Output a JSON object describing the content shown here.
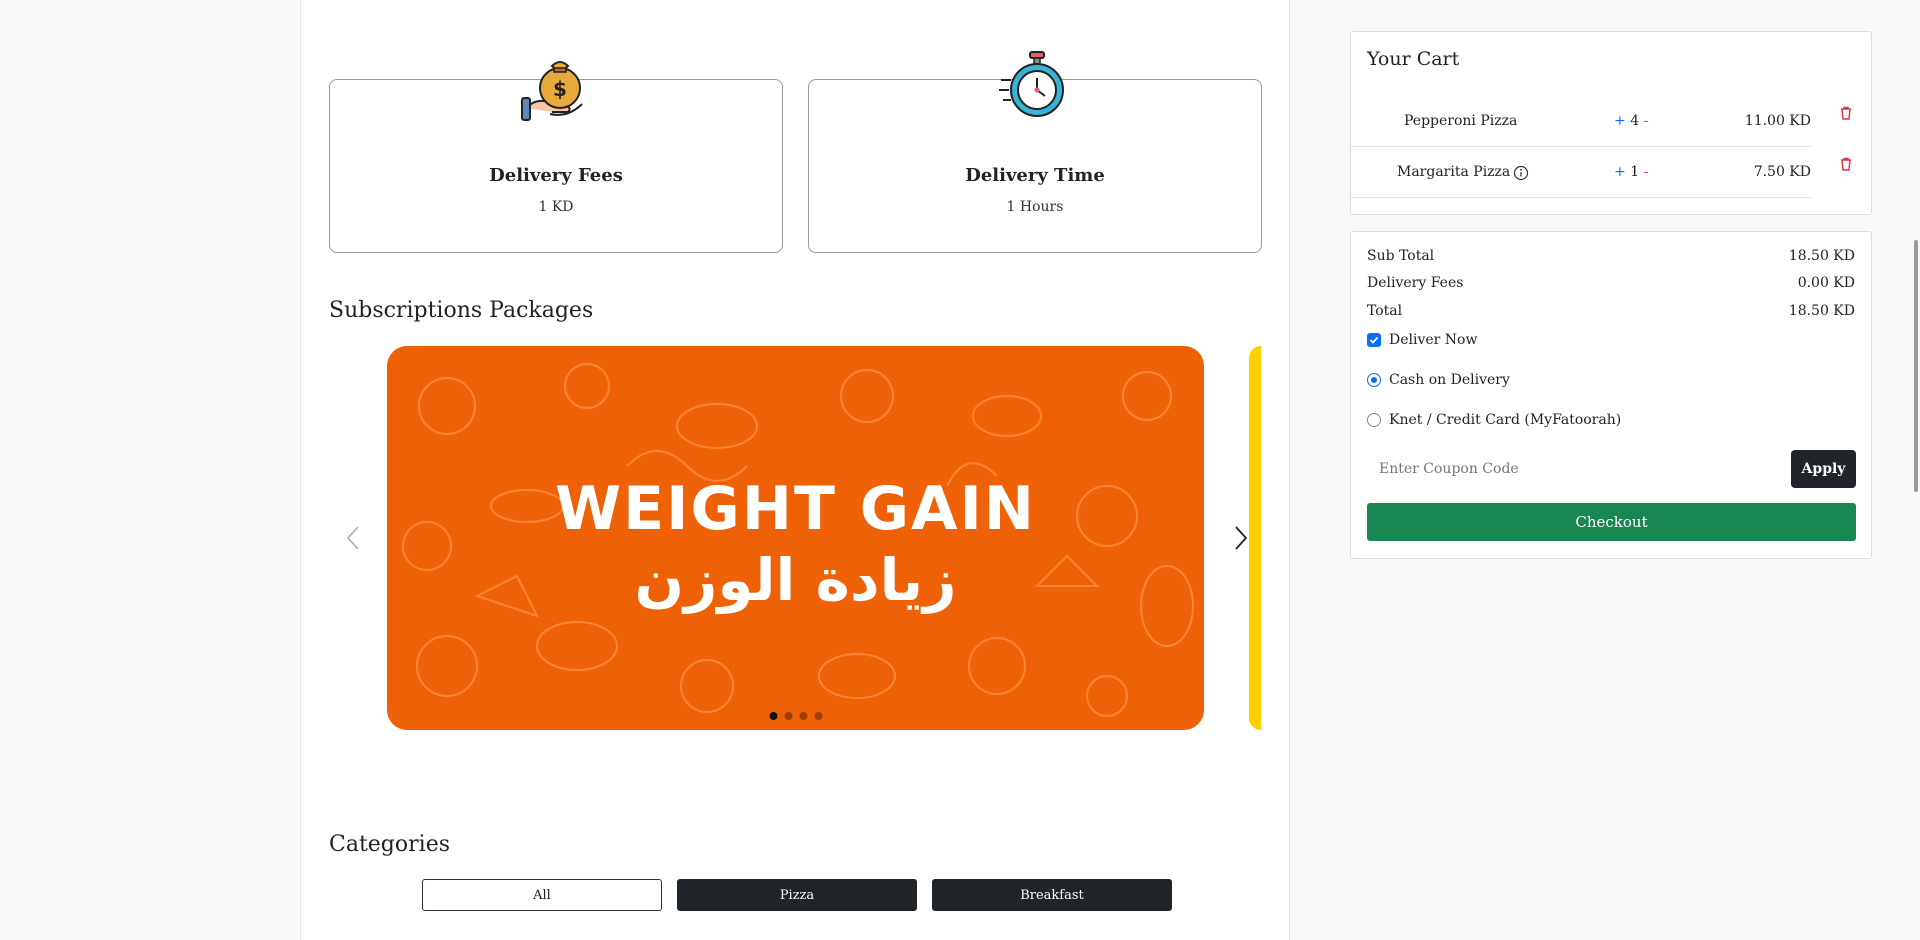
{
  "info_cards": [
    {
      "title": "Delivery Fees",
      "value": "1 KD",
      "icon": "money-bag-icon"
    },
    {
      "title": "Delivery Time",
      "value": "1 Hours",
      "icon": "stopwatch-icon"
    }
  ],
  "subscriptions": {
    "title": "Subscriptions Packages",
    "banner_title": "WEIGHT GAIN",
    "banner_subtitle": "زيادة الوزن",
    "banner_color": "#ef6107",
    "next_slide_color": "#ffd000",
    "slide_count": 4,
    "active_slide": 1
  },
  "categories": {
    "title": "Categories",
    "items": [
      "All",
      "Pizza",
      "Breakfast"
    ],
    "selected": "All"
  },
  "cart": {
    "title": "Your Cart",
    "items": [
      {
        "name": "Pepperoni Pizza",
        "plus": "+",
        "qty": "4",
        "minus": "-",
        "price": "11.00 KD",
        "has_info": false
      },
      {
        "name": "Margarita Pizza",
        "plus": "+",
        "qty": "1",
        "minus": "-",
        "price": "7.50 KD",
        "has_info": true
      }
    ]
  },
  "summary": {
    "subtotal_label": "Sub Total",
    "subtotal_value": "18.50 KD",
    "delivery_label": "Delivery Fees",
    "delivery_value": "0.00 KD",
    "total_label": "Total",
    "total_value": "18.50 KD",
    "deliver_now_label": "Deliver Now",
    "deliver_now_checked": true,
    "payment_options": [
      "Cash on Delivery",
      "Knet / Credit Card (MyFatoorah)"
    ],
    "payment_selected": "Cash on Delivery",
    "coupon_placeholder": "Enter Coupon Code",
    "coupon_value": "",
    "apply_label": "Apply",
    "checkout_label": "Checkout"
  },
  "colors": {
    "primary": "#0d6efd",
    "danger": "#dc3545",
    "success": "#198754",
    "dark": "#212529"
  }
}
